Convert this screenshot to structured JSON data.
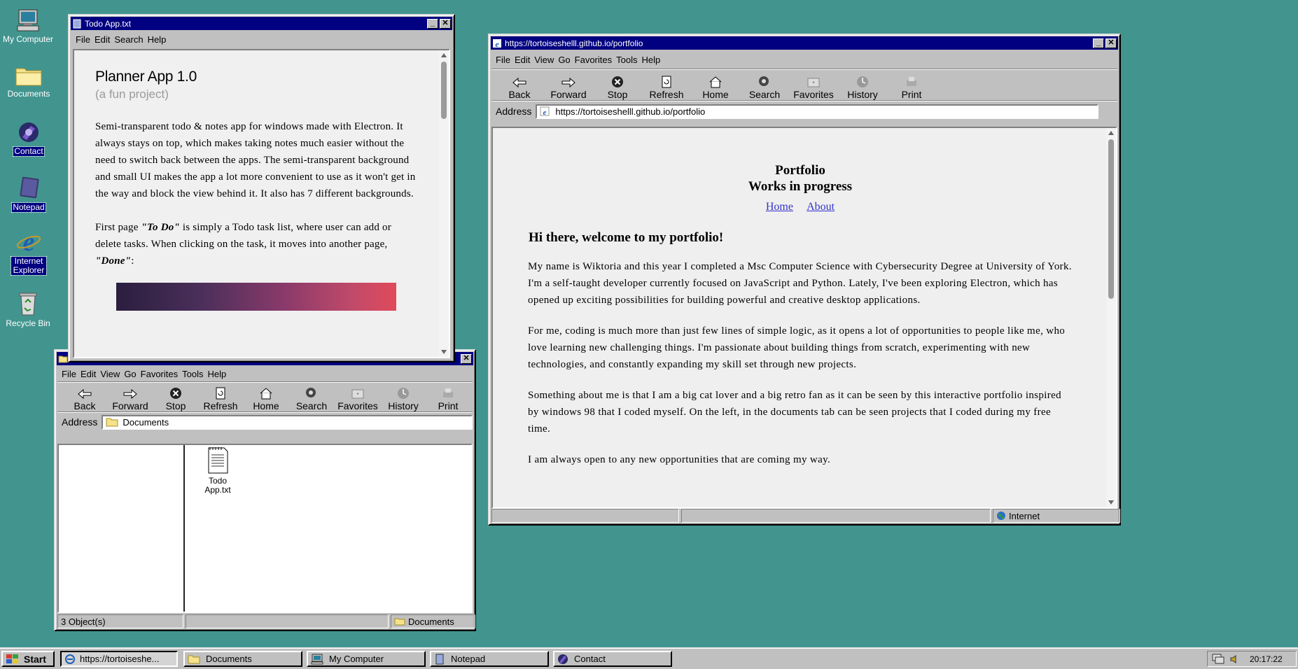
{
  "desktop": {
    "icons": [
      {
        "label": "My Computer",
        "icon": "my-computer-icon"
      },
      {
        "label": "Documents",
        "icon": "folder-icon"
      },
      {
        "label": "Contact",
        "icon": "contact-icon"
      },
      {
        "label": "Notepad",
        "icon": "notepad-icon"
      },
      {
        "label": "Internet Explorer",
        "icon": "internet-explorer-icon"
      },
      {
        "label": "Recycle Bin",
        "icon": "recycle-bin-icon"
      }
    ]
  },
  "notepad_window": {
    "title": "Todo App.txt",
    "menu": [
      "File",
      "Edit",
      "Search",
      "Help"
    ],
    "heading": "Planner App 1.0",
    "subheading": "(a fun project)",
    "para1": "Semi-transparent todo & notes app for windows made with Electron. It always stays on top, which makes taking notes much easier without the need to switch back between the apps. The semi-transparent background and small UI makes the app a lot more convenient to use as it won't get in the way and block the view behind it. It also has 7 different backgrounds.",
    "para2_a": "First page ",
    "para2_em1": "\"To Do\"",
    "para2_b": " is simply a Todo task list, where user can add or delete tasks. When clicking on the task, it moves into another page, ",
    "para2_em2": "\"Done\"",
    "para2_c": ":"
  },
  "explorer_window": {
    "menu": [
      "File",
      "Edit",
      "View",
      "Go",
      "Favorites",
      "Tools",
      "Help"
    ],
    "toolbar": [
      "Back",
      "Forward",
      "Stop",
      "Refresh",
      "Home",
      "Search",
      "Favorites",
      "History",
      "Print"
    ],
    "address_label": "Address",
    "address_value": "Documents",
    "file_label_line1": "Todo",
    "file_label_line2": "App.txt",
    "status_objects": "3 Object(s)",
    "status_location": "Documents"
  },
  "browser_window": {
    "title": "https://tortoiseshelll.github.io/portfolio",
    "menu": [
      "File",
      "Edit",
      "View",
      "Go",
      "Favorites",
      "Tools",
      "Help"
    ],
    "toolbar": [
      "Back",
      "Forward",
      "Stop",
      "Refresh",
      "Home",
      "Search",
      "Favorites",
      "History",
      "Print"
    ],
    "address_label": "Address",
    "address_value": "https://tortoiseshelll.github.io/portfolio",
    "page_title_1": "Portfolio",
    "page_title_2": "Works in progress",
    "nav": [
      "Home",
      "About"
    ],
    "greeting": "Hi there, welcome to my portfolio!",
    "p1": "My name is Wiktoria and this year I completed a Msc Computer Science with Cybersecurity Degree at University of York. I'm a self-taught developer currently focused on JavaScript and Python. Lately, I've been exploring Electron, which has opened up exciting possibilities for building powerful and creative desktop applications.",
    "p2": "For me, coding is much more than just few lines of simple logic, as it opens a lot of opportunities to people like me, who love learning new challenging things. I'm passionate about building things from scratch, experimenting with new technologies, and constantly expanding my skill set through new projects.",
    "p3": "Something about me is that I am a big cat lover and a big retro fan as it can be seen by this interactive portfolio inspired by windows 98 that I coded myself. On the left, in the documents tab can be seen projects that I coded during my free time.",
    "p4": "I am always open to any new opportunities that are coming my way.",
    "status_zone": "Internet"
  },
  "taskbar": {
    "start": "Start",
    "items": [
      "https://tortoiseshe...",
      "Documents",
      "My Computer",
      "Notepad",
      "Contact"
    ],
    "clock": "20:17:22"
  },
  "colors": {
    "desktop": "#42958f",
    "titlebar": "#000080",
    "link": "#3333cc"
  }
}
